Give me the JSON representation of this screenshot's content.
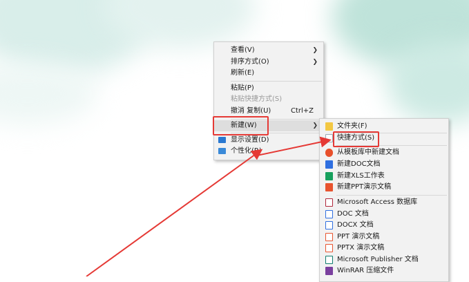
{
  "main_menu": {
    "items": [
      {
        "label": "查看(V)",
        "submenu": true
      },
      {
        "label": "排序方式(O)",
        "submenu": true
      },
      {
        "label": "刷新(E)"
      },
      {
        "label": "粘贴(P)"
      },
      {
        "label": "粘贴快捷方式(S)",
        "disabled": true
      },
      {
        "label": "撤消 复制(U)",
        "shortcut": "Ctrl+Z"
      },
      {
        "label": "新建(W)",
        "submenu": true,
        "highlighted": true
      },
      {
        "label": "显示设置(D)",
        "icon": "display-settings-icon"
      },
      {
        "label": "个性化(R)",
        "icon": "personalize-icon"
      }
    ]
  },
  "new_submenu": {
    "items": [
      {
        "label": "文件夹(F)",
        "icon": "folder-icon"
      },
      {
        "label": "快捷方式(S)",
        "icon": "shortcut-icon",
        "highlighted": true
      },
      {
        "label": "从模板库中新建文档",
        "icon": "template-icon"
      },
      {
        "label": "新建DOC文档",
        "icon": "wps-doc-icon"
      },
      {
        "label": "新建XLS工作表",
        "icon": "wps-xls-icon"
      },
      {
        "label": "新建PPT演示文稿",
        "icon": "wps-ppt-icon"
      },
      {
        "label": "Microsoft Access 数据库",
        "icon": "access-icon"
      },
      {
        "label": "DOC 文档",
        "icon": "doc-file-icon"
      },
      {
        "label": "DOCX 文档",
        "icon": "docx-file-icon"
      },
      {
        "label": "PPT 演示文稿",
        "icon": "ppt-file-icon"
      },
      {
        "label": "PPTX 演示文稿",
        "icon": "pptx-file-icon"
      },
      {
        "label": "Microsoft Publisher 文档",
        "icon": "publisher-icon"
      },
      {
        "label": "WinRAR 压缩文件",
        "icon": "winrar-icon"
      }
    ]
  },
  "colors": {
    "annotation_red": "#e53935",
    "menu_bg": "#f2f2f2",
    "wallpaper_tint": "#cfe8e2"
  }
}
